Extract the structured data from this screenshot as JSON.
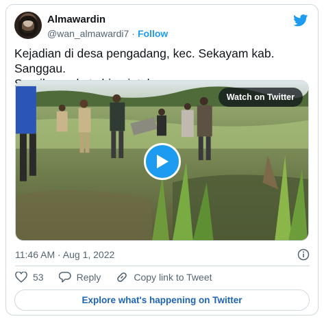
{
  "author": {
    "display_name": "Almawardin",
    "handle": "@wan_almawardi7",
    "separator": "·",
    "follow_label": "Follow"
  },
  "tweet": {
    "text": "Kejadian di desa pengadang, kec. Sekayam kab. Sanggau.\nSerpihan roket china jatuh."
  },
  "media": {
    "watch_label": "Watch on Twitter",
    "play_icon": "play-icon"
  },
  "meta": {
    "timestamp": "11:46 AM · Aug 1, 2022",
    "info_icon": "info-icon"
  },
  "actions": {
    "like_count": "53",
    "reply_label": "Reply",
    "copy_link_label": "Copy link to Tweet"
  },
  "footer": {
    "explore_label": "Explore what's happening on Twitter"
  },
  "colors": {
    "accent": "#1d9bf0",
    "muted": "#536471",
    "border": "#cfd9de",
    "explore_text": "#1d63b8"
  }
}
